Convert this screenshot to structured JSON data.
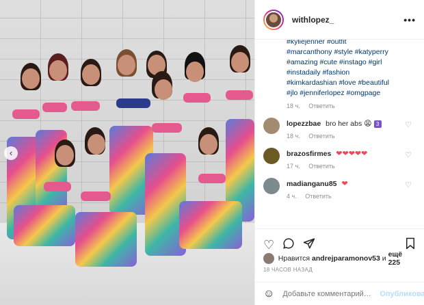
{
  "post": {
    "username": "withlopez_",
    "more_icon": "more-dots-icon"
  },
  "caption": {
    "hashtags": [
      "#kyliejenner #outfit",
      "#marcanthony #style #katyperry",
      "#amazing #cute #instago #girl",
      "#instadaily #fashion",
      "#kimkardashian #love #beautiful",
      "#jlo #jenniferlopez #omgpage"
    ],
    "time": "18 ч.",
    "reply": "Ответить"
  },
  "comments": [
    {
      "user": "lopezzbae",
      "text": "bro her abs",
      "emoji": "😩",
      "badge": "3",
      "time": "18 ч.",
      "reply": "Ответить",
      "avatar_color": "#a38b70"
    },
    {
      "user": "brazosfirmes",
      "text": "",
      "emoji": "❤❤❤❤❤",
      "badge": "",
      "time": "17 ч.",
      "reply": "Ответить",
      "avatar_color": "#6b5a23"
    },
    {
      "user": "madianganu85",
      "text": "",
      "emoji": "❤",
      "badge": "",
      "time": "4 ч.",
      "reply": "Ответить",
      "avatar_color": "#7c8a8e"
    }
  ],
  "actions": {
    "like_icon": "heart-icon",
    "comment_icon": "comment-icon",
    "share_icon": "share-icon",
    "save_icon": "bookmark-icon"
  },
  "likes": {
    "prefix": "Нравится",
    "user": "andrejparamonov53",
    "connector": "и",
    "rest": "ещё 225"
  },
  "timeago": "18 ЧАСОВ НАЗАД",
  "add_comment": {
    "placeholder": "Добавьте комментарий…",
    "publish_label": "Опубликовать"
  },
  "colors": {
    "link": "#00376b",
    "muted": "#8e8e8e",
    "heart": "#ed4956",
    "publish_disabled": "#b2dffc"
  }
}
